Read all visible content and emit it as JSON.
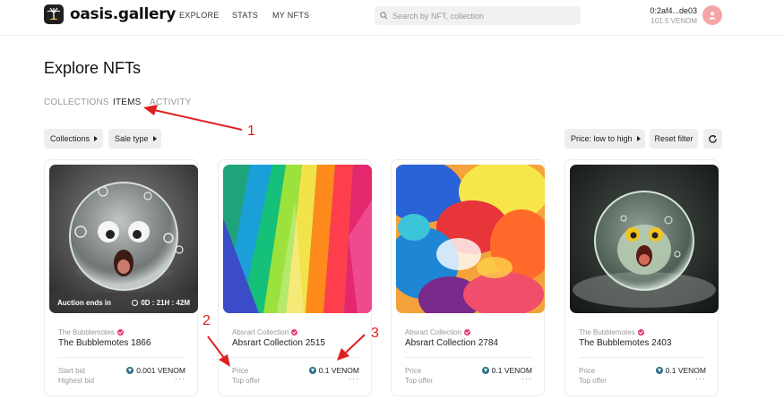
{
  "header": {
    "logo_text": "oasis.gallery",
    "nav": [
      "EXPLORE",
      "STATS",
      "MY NFTS"
    ],
    "search_placeholder": "Search by NFT, collection",
    "account_address": "0:2af4...de03",
    "account_balance": "101.5 VENOM"
  },
  "page": {
    "title": "Explore NFTs",
    "tabs": [
      "COLLECTIONS",
      "ITEMS",
      "ACTIVITY"
    ],
    "active_tab": "ITEMS"
  },
  "filters": {
    "collections": "Collections",
    "sale_type": "Sale type",
    "sort": "Price: low to high",
    "reset": "Reset filter"
  },
  "cards": [
    {
      "collection": "The Bubblemotes",
      "name": "The Bubblemotes 1866",
      "label1": "Start bid",
      "label2": "Highest bid",
      "price": "0.001 VENOM",
      "more": "···",
      "auction_label": "Auction ends in",
      "auction_timer": "0D : 21H : 42M"
    },
    {
      "collection": "Absrart Collection",
      "name": "Absrart Collection 2515",
      "label1": "Price",
      "label2": "Top offer",
      "price": "0.1 VENOM",
      "more": "···"
    },
    {
      "collection": "Absrart Collection",
      "name": "Absrart Collection 2784",
      "label1": "Price",
      "label2": "Top offer",
      "price": "0.1 VENOM",
      "more": "···"
    },
    {
      "collection": "The Bubblemotes",
      "name": "The Bubblemotes 2403",
      "label1": "Price",
      "label2": "Top offer",
      "price": "0.1 VENOM",
      "more": "···"
    }
  ],
  "annotations": [
    "1",
    "2",
    "3"
  ],
  "colors": {
    "annotation": "#e02020",
    "verified_badge": "#e5336c",
    "avatar": "#f4a6a6",
    "venom_token": "#2d6f8a"
  }
}
